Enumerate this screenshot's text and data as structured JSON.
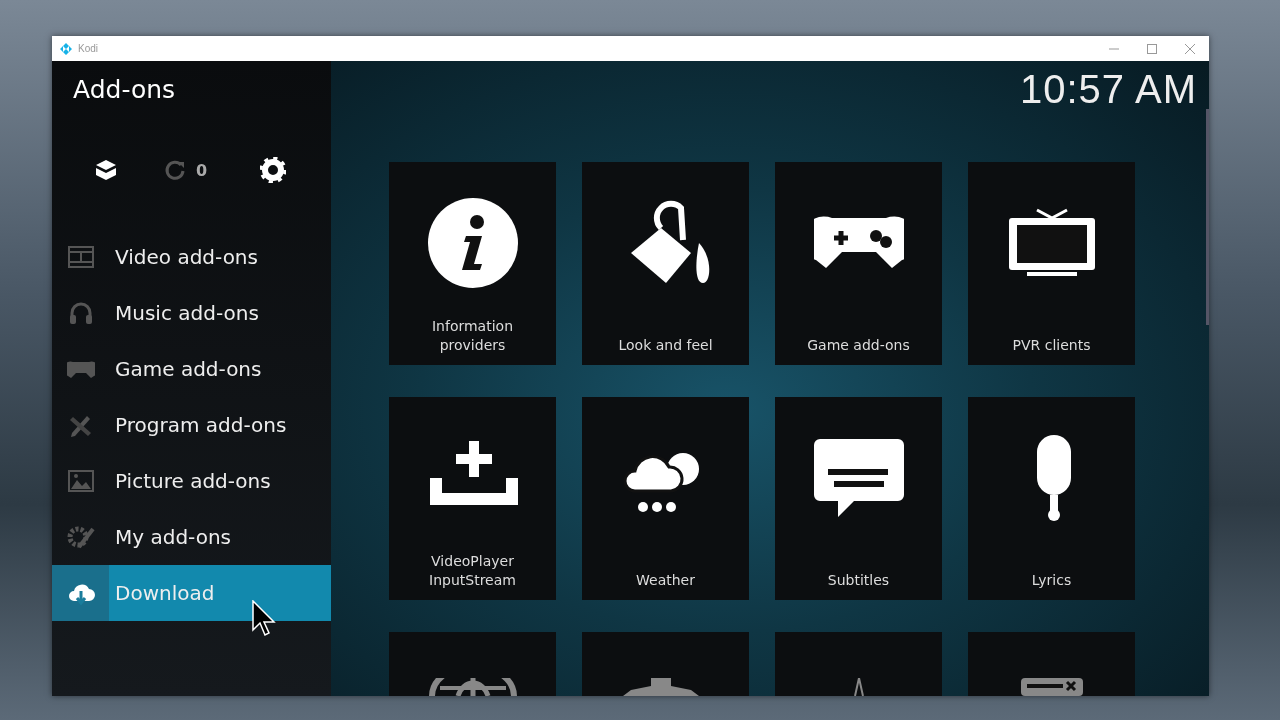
{
  "window": {
    "title": "Kodi"
  },
  "sidebar": {
    "heading": "Add-ons",
    "update_count": "0",
    "items": [
      {
        "label": "Video add-ons",
        "selected": false
      },
      {
        "label": "Music add-ons",
        "selected": false
      },
      {
        "label": "Game add-ons",
        "selected": false
      },
      {
        "label": "Program add-ons",
        "selected": false
      },
      {
        "label": "Picture add-ons",
        "selected": false
      },
      {
        "label": "My add-ons",
        "selected": false
      },
      {
        "label": "Download",
        "selected": true
      }
    ]
  },
  "clock": "10:57 AM",
  "tiles": [
    {
      "label": "Information providers"
    },
    {
      "label": "Look and feel"
    },
    {
      "label": "Game add-ons"
    },
    {
      "label": "PVR clients"
    },
    {
      "label": "VideoPlayer InputStream"
    },
    {
      "label": "Weather"
    },
    {
      "label": "Subtitles"
    },
    {
      "label": "Lyrics"
    }
  ]
}
